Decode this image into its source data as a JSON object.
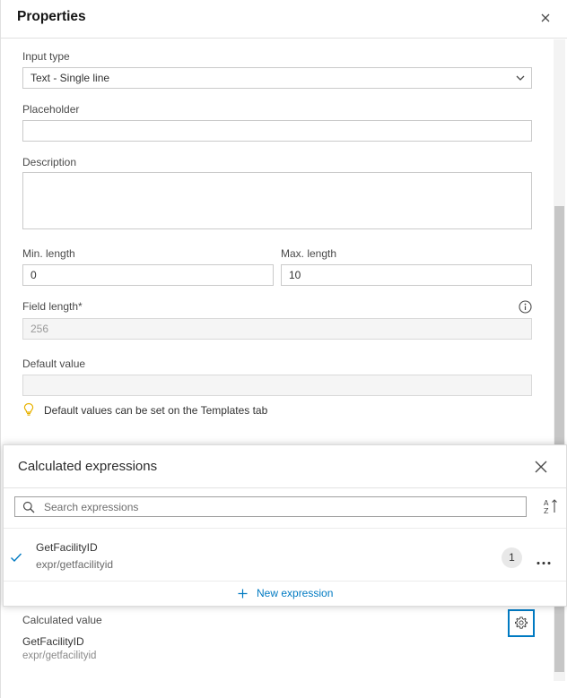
{
  "panel": {
    "title": "Properties"
  },
  "fields": {
    "input_type": {
      "label": "Input type",
      "value": "Text - Single line"
    },
    "placeholder": {
      "label": "Placeholder",
      "value": ""
    },
    "description": {
      "label": "Description",
      "value": ""
    },
    "min_length": {
      "label": "Min. length",
      "value": "0"
    },
    "max_length": {
      "label": "Max. length",
      "value": "10"
    },
    "field_length": {
      "label": "Field length*",
      "value": "256"
    },
    "default_value": {
      "label": "Default value",
      "value": ""
    },
    "default_hint": "Default values can be set on the Templates tab"
  },
  "popover": {
    "title": "Calculated expressions",
    "search_placeholder": "Search expressions",
    "expressions": [
      {
        "name": "GetFacilityID",
        "path": "expr/getfacilityid",
        "count": "1",
        "selected": true
      }
    ],
    "new_expression_label": "New expression"
  },
  "calculated_value": {
    "label": "Calculated value",
    "name": "GetFacilityID",
    "path": "expr/getfacilityid"
  },
  "colors": {
    "accent": "#007ac2",
    "border": "#cacaca",
    "disabled_bg": "#f5f5f5"
  },
  "icons": [
    "close-icon",
    "chevron-down-icon",
    "info-icon",
    "lightbulb-icon",
    "search-icon",
    "sort-icon",
    "check-icon",
    "more-icon",
    "plus-icon",
    "gear-icon"
  ]
}
